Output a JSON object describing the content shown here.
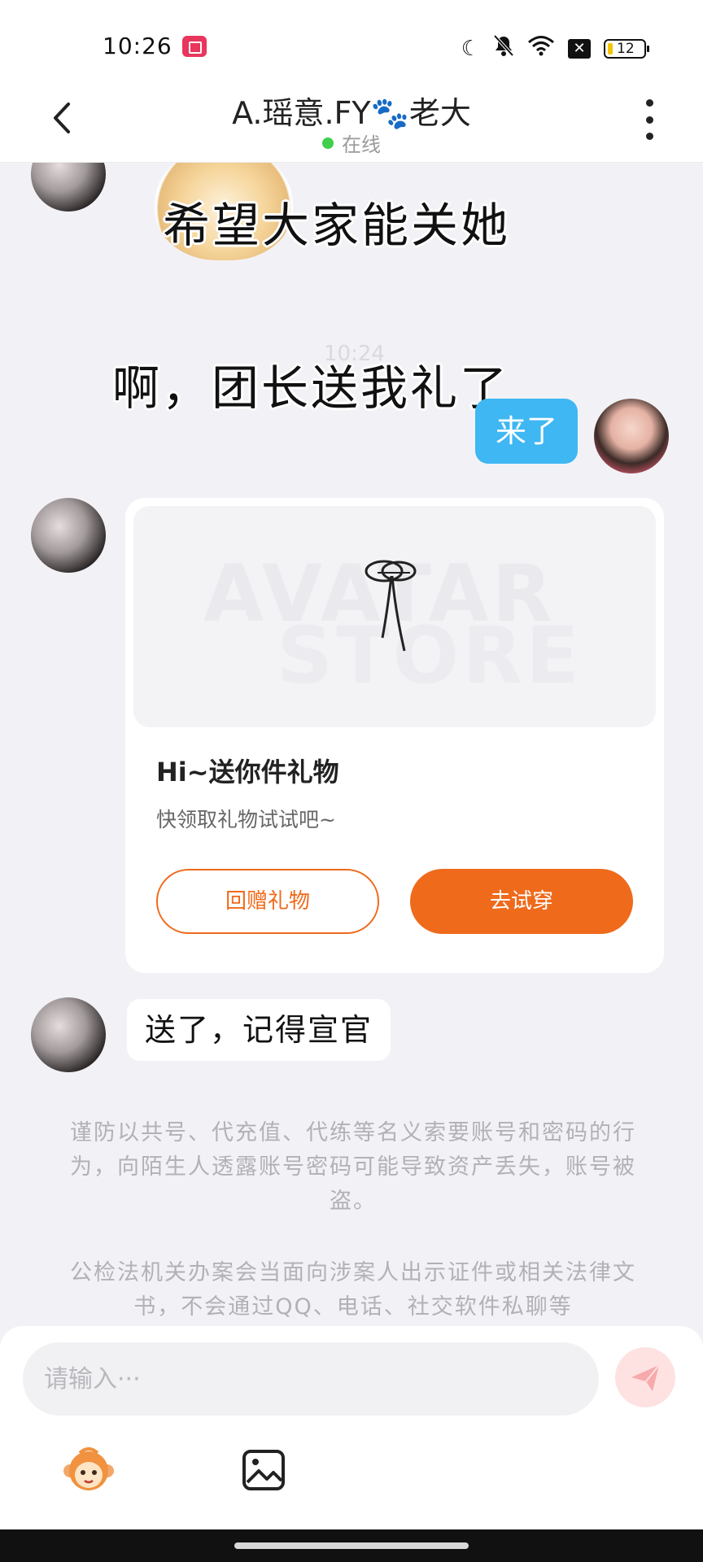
{
  "status_bar": {
    "time": "10:26",
    "battery": "12",
    "icons": [
      "screen-record-icon",
      "moon-icon",
      "mute-icon",
      "wifi-icon",
      "no-sim-icon",
      "battery-icon"
    ]
  },
  "header": {
    "back_label": "<",
    "title": "A.瑶意.FY🐾老大",
    "status": "在线"
  },
  "captions": {
    "line1": "希望大家能关她",
    "line2": "啊，团长送我礼了"
  },
  "faint_timestamp": "10:24",
  "messages": {
    "self_text": "来了",
    "other_text": "送了，记得宣官"
  },
  "gift_card": {
    "watermark_line1": "AVATAR",
    "watermark_line2": "STORE",
    "title": "Hi~送你件礼物",
    "subtitle": "快领取礼物试试吧~",
    "return_gift_label": "回赠礼物",
    "try_on_label": "去试穿"
  },
  "notices": {
    "account_safety": "谨防以共号、代充值、代练等名义索要账号和密码的行为，向陌生人透露账号密码可能导致资产丢失，账号被盗。",
    "law_enforcement": "公检法机关办案会当面向涉案人出示证件或相关法律文书，不会通过QQ、电话、社交软件私聊等"
  },
  "composer": {
    "placeholder": "请输入···"
  },
  "colors": {
    "accent_orange": "#ef6a1b",
    "self_bubble_blue": "#3eb7f2",
    "online_green": "#3fcf4d"
  }
}
